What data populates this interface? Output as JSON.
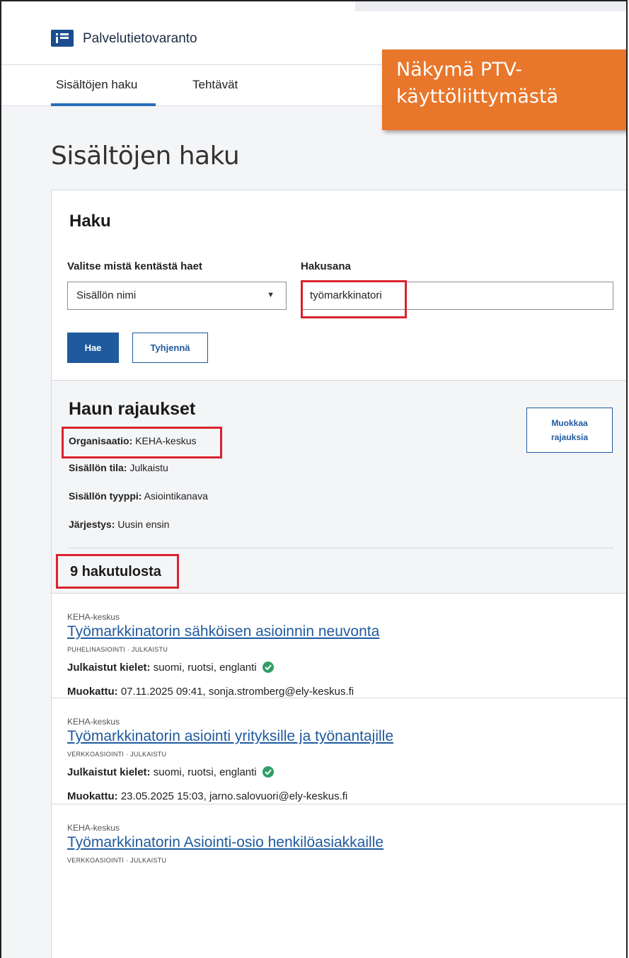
{
  "app": {
    "name": "Palvelutietovaranto"
  },
  "nav": {
    "tabs": [
      {
        "label": "Sisältöjen haku"
      },
      {
        "label": "Tehtävät"
      }
    ]
  },
  "callout": {
    "line1": "Näkymä PTV-",
    "line2": "käyttöliittymästä"
  },
  "page": {
    "title": "Sisältöjen haku"
  },
  "search": {
    "title": "Haku",
    "field_label": "Valitse mistä kentästä haet",
    "field_value": "Sisällön nimi",
    "keyword_label": "Hakusana",
    "keyword_value": "työmarkkinatori",
    "search_button": "Hae",
    "clear_button": "Tyhjennä"
  },
  "filters": {
    "title": "Haun rajaukset",
    "edit_button_line1": "Muokkaa",
    "edit_button_line2": "rajauksia",
    "rows": [
      {
        "label": "Organisaatio:",
        "value": "KEHA-keskus"
      },
      {
        "label": "Sisällön tila:",
        "value": "Julkaistu"
      },
      {
        "label": "Sisällön tyyppi:",
        "value": "Asiointikanava"
      },
      {
        "label": "Järjestys:",
        "value": "Uusin ensin"
      }
    ],
    "results_count": "9 hakutulosta"
  },
  "results": [
    {
      "org": "KEHA-keskus",
      "title": "Työmarkkinatorin sähköisen asioinnin neuvonta",
      "meta": "PUHELINASIOINTI · JULKAISTU",
      "lang_label": "Julkaistut kielet:",
      "lang_value": "suomi, ruotsi, englanti",
      "mod_label": "Muokattu:",
      "mod_value": "07.11.2025 09:41, sonja.stromberg@ely-keskus.fi"
    },
    {
      "org": "KEHA-keskus",
      "title": "Työmarkkinatorin asiointi yrityksille ja työnantajille",
      "meta": "VERKKOASIOINTI · JULKAISTU",
      "lang_label": "Julkaistut kielet:",
      "lang_value": "suomi, ruotsi, englanti",
      "mod_label": "Muokattu:",
      "mod_value": "23.05.2025 15:03, jarno.salovuori@ely-keskus.fi"
    },
    {
      "org": "KEHA-keskus",
      "title": "Työmarkkinatorin Asiointi-osio henkilöasiakkaille",
      "meta": "VERKKOASIOINTI · JULKAISTU"
    }
  ],
  "colors": {
    "brand": "#1a4d8f",
    "link": "#1f5a9e",
    "highlight": "#d9232e",
    "callout": "#e8762b",
    "check": "#2f9e66"
  }
}
